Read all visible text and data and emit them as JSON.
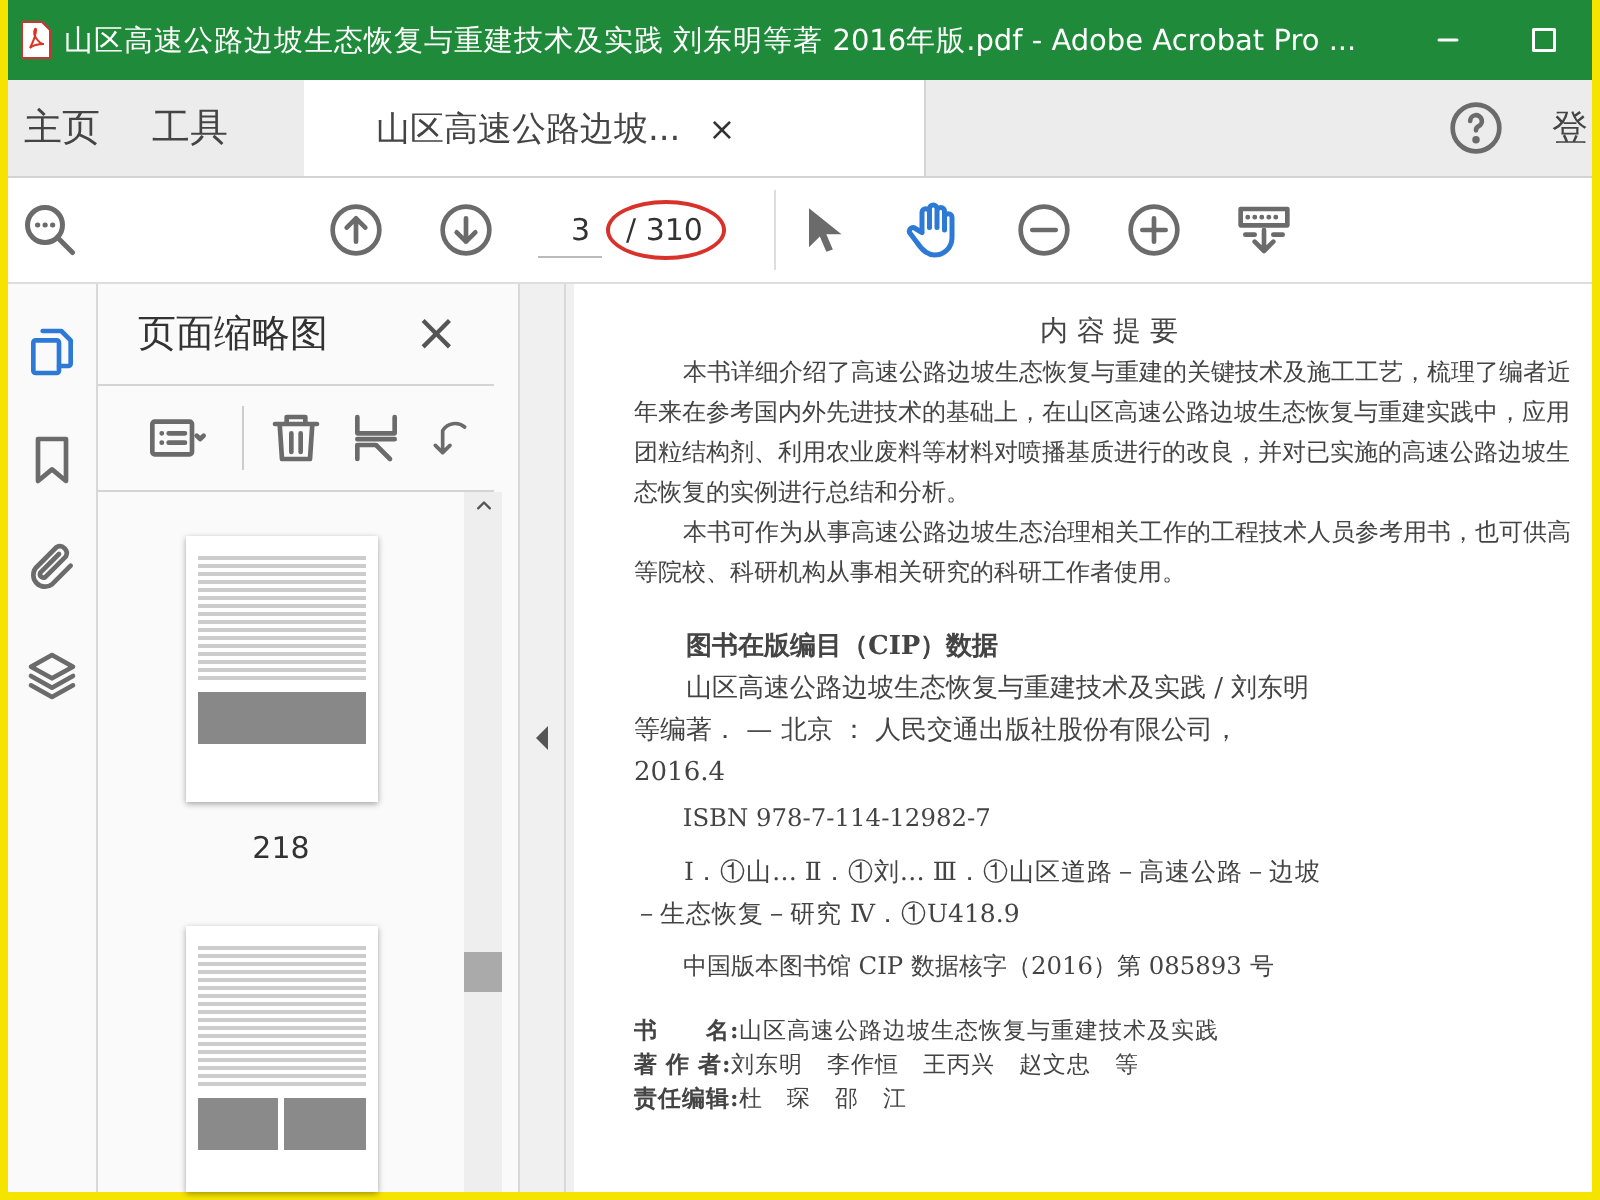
{
  "window": {
    "title": "山区高速公路边坡生态恢复与重建技术及实践 刘东明等著 2016年版.pdf - Adobe Acrobat Pro ..."
  },
  "tabs": [
    {
      "label": "主页",
      "kind": "nav",
      "selected": false
    },
    {
      "label": "工具",
      "kind": "nav",
      "selected": false
    },
    {
      "label": "山区高速公路边坡...",
      "kind": "document",
      "selected": true,
      "close": "×"
    }
  ],
  "account_label": "登",
  "toolbar": {
    "page_current": "3",
    "page_total": "/ 310"
  },
  "side_rail": [
    {
      "kind": "pages",
      "selected": true
    },
    {
      "kind": "bookmark",
      "selected": false
    },
    {
      "kind": "attachment",
      "selected": false
    },
    {
      "kind": "layers",
      "selected": false
    }
  ],
  "thumbnail_panel": {
    "title": "页面缩略图",
    "close": "×",
    "thumbnails": [
      {
        "label": "218",
        "kind": "photo_bottom"
      },
      {
        "kind": "two_photos"
      }
    ]
  },
  "document": {
    "heading": "内 容 提 要",
    "paragraphs": [
      "本书详细介绍了高速公路边坡生态恢复与重建的关键技术及施工工艺，梳理了编者近年来在参考国内外先进技术的基础上，在山区高速公路边坡生态恢复与重建实践中，应用团粒结构剂、利用农业废料等材料对喷播基质进行的改良，并对已实施的高速公路边坡生态恢复的实例进行总结和分析。",
      "本书可作为从事高速公路边坡生态治理相关工作的工程技术人员参考用书，也可供高等院校、科研机构从事相关研究的科研工作者使用。"
    ],
    "cip_title": "图书在版编目（CIP）数据",
    "cip_entry": "山区高速公路边坡生态恢复与重建技术及实践 / 刘东明等编著． — 北京 ： 人民交通出版社股份有限公司， 2016.4",
    "isbn": "ISBN 978-7-114-12982-7",
    "classification": "Ⅰ．①山… Ⅱ．①刘… Ⅲ．①山区道路－高速公路－边坡－生态恢复－研究 Ⅳ．①U418.9",
    "cip_number": "中国版本图书馆 CIP 数据核字（2016）第 085893 号",
    "credits": [
      {
        "label": "书　　名:",
        "value": "山区高速公路边坡生态恢复与重建技术及实践"
      },
      {
        "label": "著 作 者:",
        "value": "刘东明　李作恒　王丙兴　赵文忠　等"
      },
      {
        "label": "责任编辑:",
        "value": "杜　琛　邵　江"
      }
    ]
  }
}
